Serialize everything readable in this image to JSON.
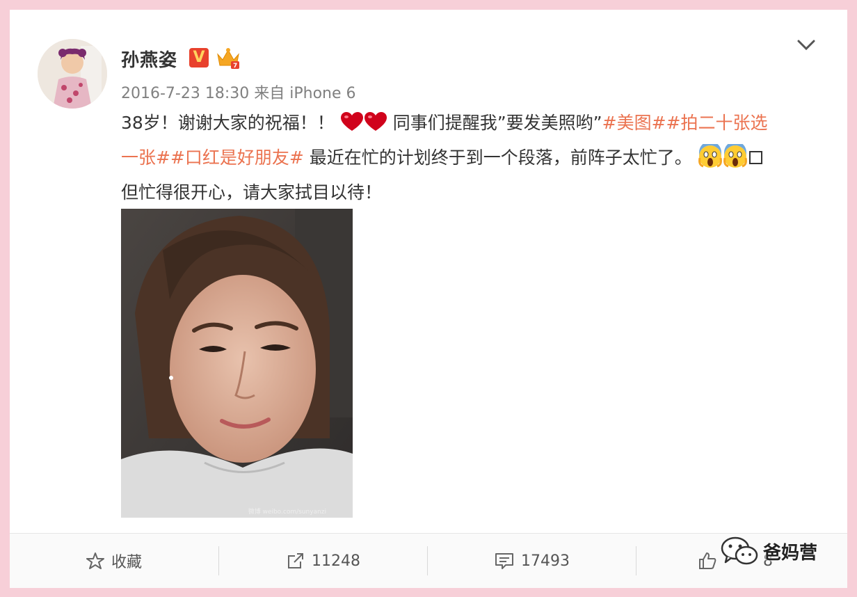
{
  "post": {
    "username": "孙燕姿",
    "verified_badge": "V",
    "timestamp": "2016-7-23 18:30",
    "source": "来自 iPhone 6",
    "content": {
      "line1_a": "38岁！谢谢大家的祝福！！",
      "line1_b": "同事们提醒我”要发美照哟”",
      "hashtag1": "#美图#",
      "hashtag2_part1": "#拍二十张选",
      "hashtag2_part2": "一张#",
      "hashtag3": "#口红是好朋友#",
      "line2_b": " 最近在忙的计划终于到一个段落，前阵子太忙了。",
      "line3": "但忙得很开心，请大家拭目以待！"
    },
    "photo_alt": "selfie photo",
    "photo_watermark": "微博 weibo.com/sunyanzi"
  },
  "actions": {
    "favorite_label": "收藏",
    "repost_count": "11248",
    "comment_count": "17493",
    "like_count": "8"
  },
  "watermark": {
    "text": "爸妈营"
  },
  "colors": {
    "background": "#f7cfd8",
    "hashtag": "#eb7350",
    "text": "#333333",
    "meta": "#808080"
  },
  "icons": [
    "verified-icon",
    "crown-icon",
    "chevron-down-icon",
    "heart-icon",
    "scream-icon",
    "star-icon",
    "repost-icon",
    "comment-icon",
    "thumbs-up-icon",
    "wechat-icon"
  ]
}
